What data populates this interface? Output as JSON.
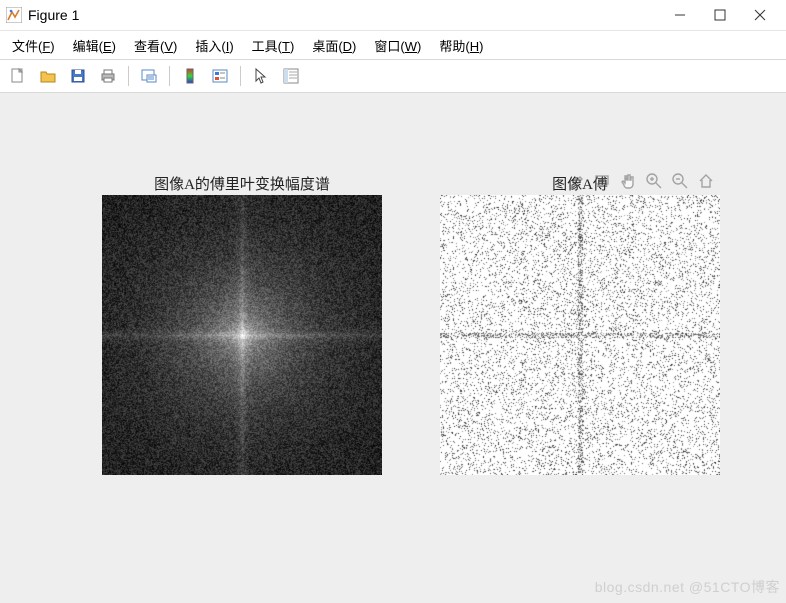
{
  "window": {
    "title": "Figure 1"
  },
  "menu": {
    "file": "文件(F)",
    "edit": "编辑(E)",
    "view": "查看(V)",
    "insert": "插入(I)",
    "tools": "工具(T)",
    "desktop": "桌面(D)",
    "window": "窗口(W)",
    "help": "帮助(H)"
  },
  "toolbar_icons": {
    "new": "new-figure-icon",
    "open": "open-icon",
    "save": "save-icon",
    "print": "print-icon",
    "data_cursor": "data-cursor-icon",
    "colorbar": "colorbar-icon",
    "legend": "legend-icon",
    "pointer": "pointer-icon",
    "property": "property-inspector-icon"
  },
  "figures": {
    "left_title": "图像A的傅里叶变换幅度谱",
    "right_title": "图像A傅"
  },
  "axes_toolbar": {
    "brush": "brush-icon",
    "datacursor": "data-tip-icon",
    "pan": "pan-icon",
    "zoom_in": "zoom-in-icon",
    "zoom_out": "zoom-out-icon",
    "home": "home-icon"
  },
  "watermark": "blog.csdn.net @51CTO博客",
  "chart_data": {
    "type": "heatmap",
    "note": "Two 280×280 grayscale image panels showing FFT magnitude spectrum (left) and a second FFT-related spectrum (right). No axis ticks or numeric labels are visible. Left panel: dark noisy grayscale with a bright center and faint horizontal+vertical bright lines through center. Right panel: mostly white salt-and-pepper noise with very faint darker horizontal+vertical bands crossing at center.",
    "panels": [
      {
        "title": "图像A的傅里叶变换幅度谱",
        "style": "dark-center-bright-cross",
        "colormap": "gray",
        "center_bright": true,
        "cross_lines": true,
        "xlim": [
          0,
          1
        ],
        "ylim": [
          0,
          1
        ]
      },
      {
        "title": "图像A傅",
        "style": "white-noise-faint-cross",
        "colormap": "gray-inverted",
        "center_bright": false,
        "cross_lines": true,
        "xlim": [
          0,
          1
        ],
        "ylim": [
          0,
          1
        ]
      }
    ]
  }
}
